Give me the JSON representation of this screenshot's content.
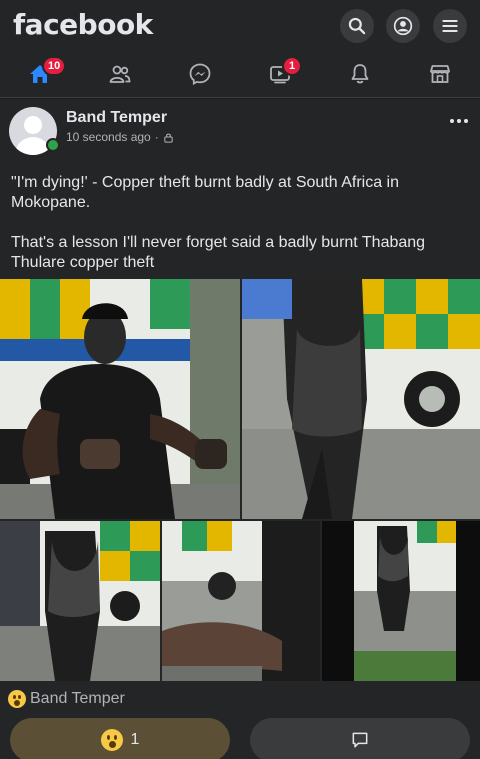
{
  "app": {
    "logo_text": "facebook"
  },
  "topbar": {
    "icons": [
      "search-icon",
      "profile-icon",
      "menu-icon"
    ]
  },
  "nav": {
    "active": "home",
    "items": [
      {
        "name": "home",
        "icon": "home-icon",
        "badge": "10"
      },
      {
        "name": "friends",
        "icon": "friends-icon",
        "badge": ""
      },
      {
        "name": "messenger",
        "icon": "messenger-icon",
        "badge": ""
      },
      {
        "name": "watch",
        "icon": "video-icon",
        "badge": "1"
      },
      {
        "name": "notifications",
        "icon": "bell-icon",
        "badge": ""
      },
      {
        "name": "marketplace",
        "icon": "marketplace-icon",
        "badge": ""
      }
    ]
  },
  "post": {
    "author": "Band Temper",
    "timestamp": "10 seconds ago",
    "separator": "·",
    "privacy_icon": "lock-icon",
    "text_paragraph_1": "\"I'm dying!' - Copper theft burnt badly at South Africa  in Mokopane.",
    "text_paragraph_2": "That's a lesson I'll never forget said a badly burnt Thabang Thulare copper theft",
    "photo_count": 5,
    "reaction_summary_name": "Band Temper",
    "reaction_emoji": "wow-emoji-icon",
    "reaction_count": "1"
  },
  "colors": {
    "background": "#18191a",
    "surface": "#242526",
    "accent": "#2d88ff",
    "badge": "#e41e3f",
    "online": "#31a24c",
    "react_button": "#5b4f35"
  }
}
